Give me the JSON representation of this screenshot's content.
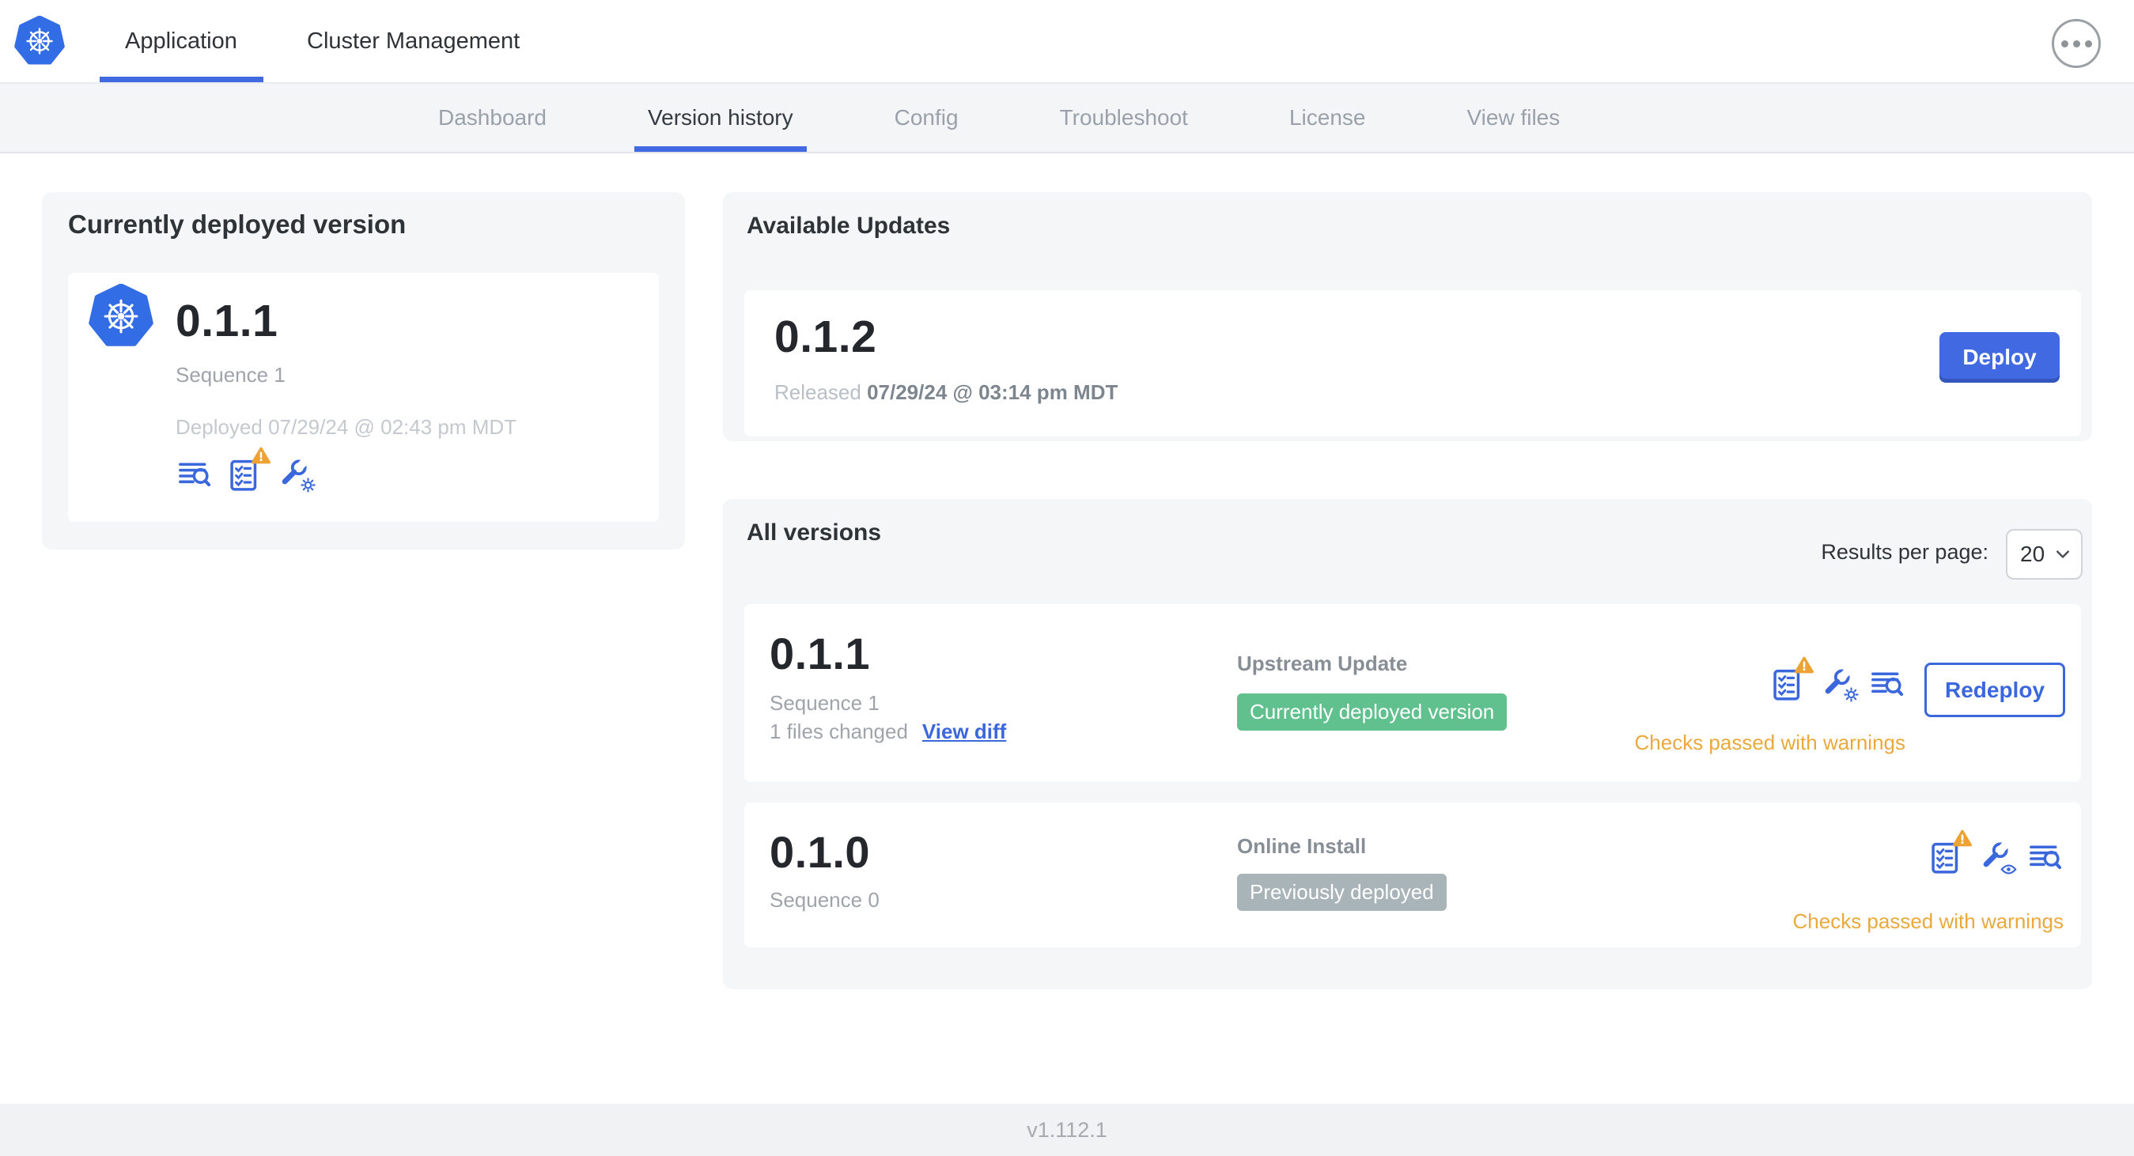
{
  "header": {
    "tabs": [
      {
        "label": "Application"
      },
      {
        "label": "Cluster Management"
      }
    ]
  },
  "subnav": {
    "tabs": [
      {
        "label": "Dashboard"
      },
      {
        "label": "Version history"
      },
      {
        "label": "Config"
      },
      {
        "label": "Troubleshoot"
      },
      {
        "label": "License"
      },
      {
        "label": "View files"
      }
    ]
  },
  "current_version_card": {
    "title": "Currently deployed version",
    "version": "0.1.1",
    "sequence": "Sequence 1",
    "deployed": "Deployed 07/29/24 @ 02:43 pm MDT"
  },
  "available_updates": {
    "title": "Available Updates",
    "version": "0.1.2",
    "released_prefix": "Released ",
    "released_date": "07/29/24 @ 03:14 pm MDT",
    "deploy_label": "Deploy"
  },
  "all_versions": {
    "title": "All versions",
    "results_per_page_label": "Results per page:",
    "results_per_page_value": "20",
    "rows": [
      {
        "version": "0.1.1",
        "sequence": "Sequence 1",
        "files_changed": "1 files changed",
        "view_diff_label": "View diff",
        "source": "Upstream Update",
        "badge": "Currently deployed version",
        "badge_color": "#61c18e",
        "status": "Checks passed with warnings",
        "action_label": "Redeploy"
      },
      {
        "version": "0.1.0",
        "sequence": "Sequence 0",
        "source": "Online Install",
        "badge": "Previously deployed",
        "badge_color": "#a9b4b9",
        "status": "Checks passed with warnings"
      }
    ]
  },
  "footer": {
    "app_version": "v1.112.1"
  },
  "colors": {
    "accent_blue": "#3b67dd",
    "button_blue": "#4169e1",
    "kubernetes_blue": "#326de6",
    "badge_green": "#61c18e",
    "badge_gray": "#a9b4b9",
    "warning_orange": "#e9a93d",
    "card_gray": "#f5f6f8"
  }
}
